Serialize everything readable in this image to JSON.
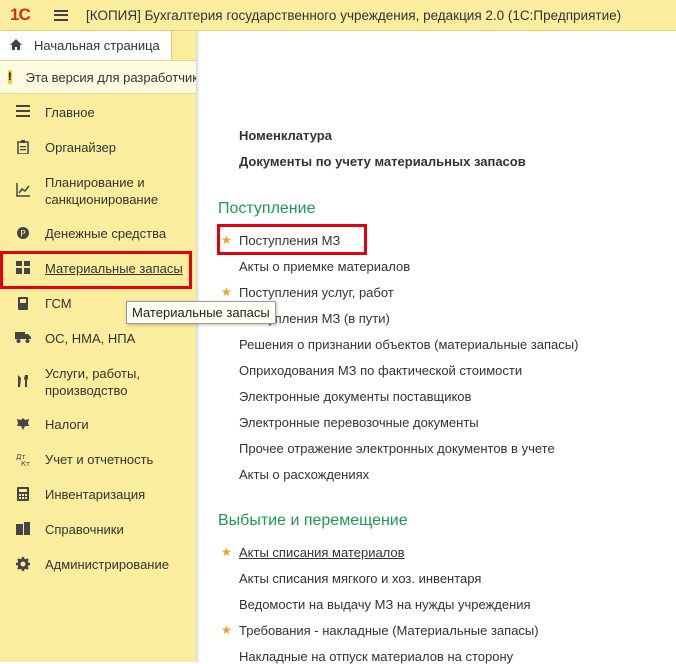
{
  "app": {
    "logo": "1С",
    "title": "[КОПИЯ] Бухгалтерия государственного учреждения, редакция 2.0  (1С:Предприятие)"
  },
  "home_tab": {
    "label": "Начальная страница",
    "icon": "home-icon"
  },
  "warning": {
    "text": "Эта версия для разработчиков",
    "icon": "warning-icon"
  },
  "sidebar": {
    "items": [
      {
        "label": "Главное",
        "icon": "list-icon"
      },
      {
        "label": "Органайзер",
        "icon": "clipboard-icon"
      },
      {
        "label": "Планирование и санкционирование",
        "icon": "chart-icon"
      },
      {
        "label": "Денежные средства",
        "icon": "coins-icon"
      },
      {
        "label": "Материальные запасы",
        "icon": "grid-icon",
        "active": true
      },
      {
        "label": "ГСМ",
        "icon": "fuel-icon"
      },
      {
        "label": "ОС, НМА, НПА",
        "icon": "truck-icon"
      },
      {
        "label": "Услуги, работы, производство",
        "icon": "tools-icon"
      },
      {
        "label": "Налоги",
        "icon": "emblem-icon"
      },
      {
        "label": "Учет и отчетность",
        "icon": "debit-credit-icon"
      },
      {
        "label": "Инвентаризация",
        "icon": "calculator-icon"
      },
      {
        "label": "Справочники",
        "icon": "books-icon"
      },
      {
        "label": "Администрирование",
        "icon": "gear-icon"
      }
    ]
  },
  "tooltip": {
    "text": "Материальные запасы"
  },
  "content": {
    "top_links": [
      "Номенклатура",
      "Документы по учету материальных запасов"
    ],
    "sections": [
      {
        "title": "Поступление",
        "links": [
          {
            "label": "Поступления МЗ",
            "starred": true
          },
          {
            "label": "Акты о приемке материалов",
            "starred": false
          },
          {
            "label": "Поступления услуг, работ",
            "starred": true
          },
          {
            "label": "Поступления МЗ (в пути)",
            "starred": false
          },
          {
            "label": "Решения о признании объектов (материальные запасы)",
            "starred": false
          },
          {
            "label": "Оприходования МЗ по фактической стоимости",
            "starred": false
          },
          {
            "label": "Электронные документы поставщиков",
            "starred": false
          },
          {
            "label": "Электронные перевозочные документы",
            "starred": false
          },
          {
            "label": "Прочее отражение электронных документов в учете",
            "starred": false
          },
          {
            "label": "Акты о расхождениях",
            "starred": false
          }
        ]
      },
      {
        "title": "Выбытие и перемещение",
        "links": [
          {
            "label": "Акты списания материалов",
            "starred": true
          },
          {
            "label": "Акты списания мягкого и хоз. инвентаря",
            "starred": false
          },
          {
            "label": "Ведомости на выдачу МЗ на нужды учреждения",
            "starred": false
          },
          {
            "label": "Требования - накладные (Материальные запасы)",
            "starred": true
          },
          {
            "label": "Накладные на отпуск материалов на сторону",
            "starred": false
          }
        ]
      }
    ]
  },
  "colors": {
    "sidebar_bg": "#fbed9e",
    "section_green": "#1c9a4f",
    "highlight_red": "#e3000f",
    "star": "#f0a020"
  }
}
